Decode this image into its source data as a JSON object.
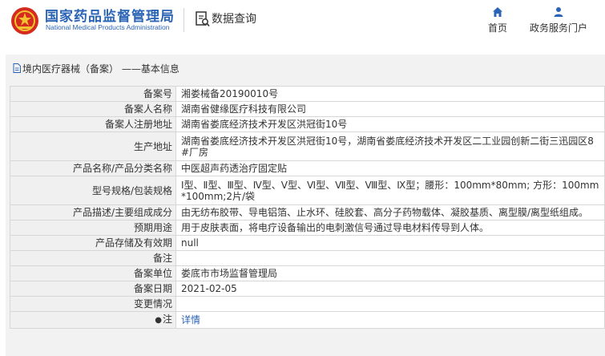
{
  "header": {
    "logo_cn": "国家药品监督管理局",
    "logo_en": "National Medical Products Administration",
    "page_title": "数据查询",
    "nav": [
      {
        "label": "首页",
        "icon": "home-icon"
      },
      {
        "label": "政务服务门户",
        "icon": "user-icon"
      }
    ]
  },
  "breadcrumb": {
    "text": "境内医疗器械（备案） ——基本信息",
    "icon": "document-icon"
  },
  "rows": [
    {
      "label": "备案号",
      "value": "湘娄械备20190010号"
    },
    {
      "label": "备案人名称",
      "value": "湖南省健缘医疗科技有限公司"
    },
    {
      "label": "备案人注册地址",
      "value": "湖南省娄底经济技术开发区洪冠街10号"
    },
    {
      "label": "生产地址",
      "value": "湖南省娄底经济技术开发区洪冠街10号，湖南省娄底经济技术开发区二工业园创新二街三迅园区8#厂房"
    },
    {
      "label": "产品名称/产品分类名称",
      "value": "中医超声药透治疗固定贴"
    },
    {
      "label": "型号规格/包装规格",
      "value": "Ⅰ型、Ⅱ型、Ⅲ型、Ⅳ型、Ⅴ型、Ⅵ型、Ⅶ型、Ⅷ型、Ⅸ型；腰形：100mm*80mm; 方形：100mm*100mm;2片/袋"
    },
    {
      "label": "产品描述/主要组成成分",
      "value": "由无纺布胶带、导电铝箔、止水环、硅胶套、高分子药物载体、凝胶基质、离型膜/离型纸组成。"
    },
    {
      "label": "预期用途",
      "value": "用于皮肤表面，将电疗设备输出的电刺激信号通过导电材料传导到人体。"
    },
    {
      "label": "产品存储及有效期",
      "value": "null"
    },
    {
      "label": "备注",
      "value": ""
    },
    {
      "label": "备案单位",
      "value": "娄底市市场监督管理局"
    },
    {
      "label": "备案日期",
      "value": "2021-02-05"
    },
    {
      "label": "变更情况",
      "value": ""
    }
  ],
  "note_row": {
    "label": "注",
    "link_text": "详情",
    "icon": "pin-icon"
  }
}
